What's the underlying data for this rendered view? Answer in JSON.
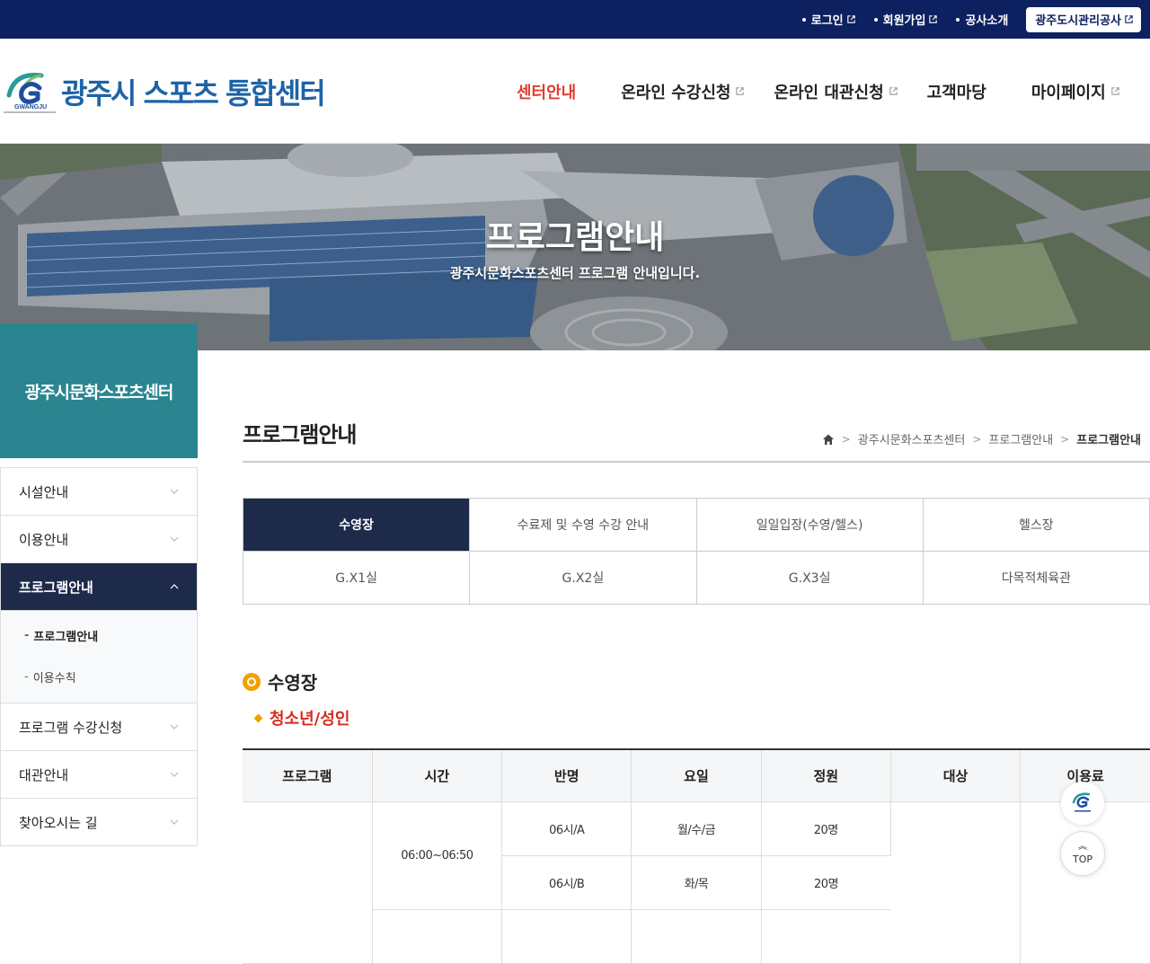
{
  "utility": {
    "login": "로그인",
    "signup": "회원가입",
    "about": "공사소개",
    "corp_button": "광주도시관리공사"
  },
  "header": {
    "logo_text": "광주시 스포츠 통합센터",
    "logo_mark_text": "GWANGJU",
    "nav": [
      {
        "label": "센터안내",
        "active": true,
        "external": false
      },
      {
        "label": "온라인 수강신청",
        "external": true
      },
      {
        "label": "온라인 대관신청",
        "external": true
      },
      {
        "label": "고객마당",
        "external": false
      },
      {
        "label": "마이페이지",
        "external": true
      }
    ]
  },
  "hero": {
    "title": "프로그램안내",
    "subtitle": "광주시문화스포츠센터 프로그램 안내입니다."
  },
  "sidebar": {
    "title": "광주시문화스포츠센터",
    "items": [
      {
        "label": "시설안내"
      },
      {
        "label": "이용안내"
      },
      {
        "label": "프로그램안내",
        "active": true
      },
      {
        "label": "프로그램 수강신청"
      },
      {
        "label": "대관안내"
      },
      {
        "label": "찾아오시는 길"
      }
    ],
    "sub_items": [
      {
        "label": "프로그램안내",
        "current": true
      },
      {
        "label": "이용수칙"
      }
    ],
    "sub_dash": "-"
  },
  "content": {
    "page_title": "프로그램안내",
    "breadcrumb": [
      "광주시문화스포츠센터",
      "프로그램안내",
      "프로그램안내"
    ],
    "tabs": [
      {
        "label": "수영장",
        "active": true
      },
      {
        "label": "수료제 및 수영 수강 안내"
      },
      {
        "label": "일일입장(수영/헬스)"
      },
      {
        "label": "헬스장"
      },
      {
        "label": "G.X1실"
      },
      {
        "label": "G.X2실"
      },
      {
        "label": "G.X3실"
      },
      {
        "label": "다목적체육관"
      }
    ],
    "section_title": "수영장",
    "sub_title": "청소년/성인",
    "table": {
      "headers": [
        "프로그램",
        "시간",
        "반명",
        "요일",
        "정원",
        "대상",
        "이용료"
      ],
      "time": "06:00~06:50",
      "rows": [
        {
          "class": "06시/A",
          "days": "월/수/금",
          "capacity": "20명"
        },
        {
          "class": "06시/B",
          "days": "화/목",
          "capacity": "20명"
        }
      ]
    }
  },
  "floating": {
    "top_label": "TOP",
    "top_arrow": "︽"
  },
  "colors": {
    "utility_bar": "#0d2160",
    "brand_blue": "#1e63a6",
    "nav_active": "#e23b2e",
    "sidebar_head": "#2b8591",
    "active_navy": "#1d2a4a",
    "bullet_orange": "#f0a000",
    "subtitle_red": "#d62b1e"
  },
  "icons": {
    "external": "external-link-icon",
    "home": "home-icon",
    "chevron": "chevron-down-icon",
    "top": "arrow-up-icon"
  }
}
